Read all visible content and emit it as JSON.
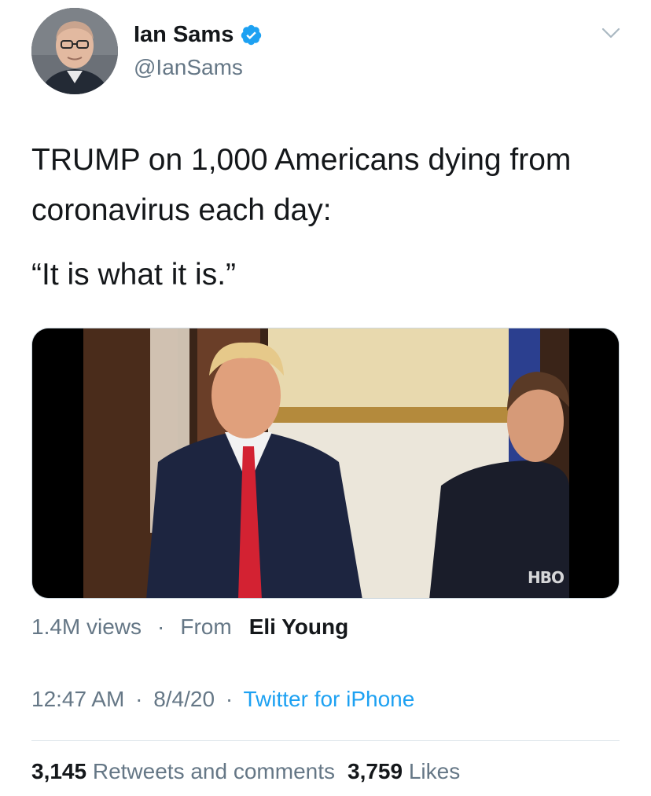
{
  "author": {
    "name": "Ian Sams",
    "handle": "@IanSams",
    "verified": true
  },
  "tweet": {
    "lines": [
      "TRUMP on 1,000 Americans dying from coronavirus each day:",
      "“It is what it is.”"
    ]
  },
  "media": {
    "watermark": "HBO"
  },
  "video_meta": {
    "views": "1.4M views",
    "separator": "·",
    "from_label": "From",
    "from_name": "Eli Young"
  },
  "timestamp": {
    "time": "12:47 AM",
    "date": "8/4/20",
    "separator": "·",
    "source": "Twitter for iPhone"
  },
  "stats": {
    "retweets_count": "3,145",
    "retweets_label": "Retweets and comments",
    "likes_count": "3,759",
    "likes_label": "Likes"
  },
  "colors": {
    "link": "#1da1f2",
    "secondary_text": "#657786",
    "verified_badge": "#1da1f2"
  },
  "icons": {
    "verified": "verified-badge-icon",
    "menu": "chevron-down-icon"
  }
}
